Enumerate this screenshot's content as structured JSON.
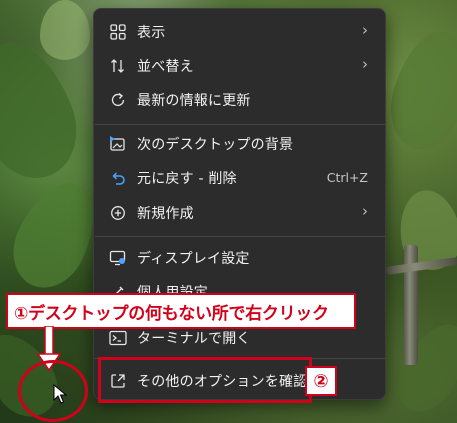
{
  "desktop": {
    "wallpaper": "jungle-forest-photo"
  },
  "context_menu": {
    "items": [
      {
        "label": "表示",
        "icon": "grid-view-icon",
        "submenu": true
      },
      {
        "label": "並べ替え",
        "icon": "sort-arrows-icon",
        "submenu": true
      },
      {
        "label": "最新の情報に更新",
        "icon": "refresh-icon",
        "submenu": false
      },
      {
        "label": "次のデスクトップの背景",
        "icon": "next-background-icon",
        "submenu": false
      },
      {
        "label": "元に戻す - 削除",
        "icon": "undo-icon",
        "shortcut": "Ctrl+Z"
      },
      {
        "label": "新規作成",
        "icon": "new-plus-icon",
        "submenu": true
      },
      {
        "label": "ディスプレイ設定",
        "icon": "display-settings-icon",
        "submenu": false
      },
      {
        "label": "個人用設定",
        "icon": "personalize-brush-icon",
        "submenu": false
      },
      {
        "label": "ターミナルで開く",
        "icon": "terminal-icon",
        "submenu": false
      },
      {
        "label": "その他のオプションを確認",
        "icon": "more-options-icon",
        "submenu": false
      }
    ],
    "chevron": "›"
  },
  "annotations": {
    "step1_text": "①デスクトップの何もない所で右クリック",
    "step2_text": "②",
    "accent_color": "#d0021b"
  }
}
